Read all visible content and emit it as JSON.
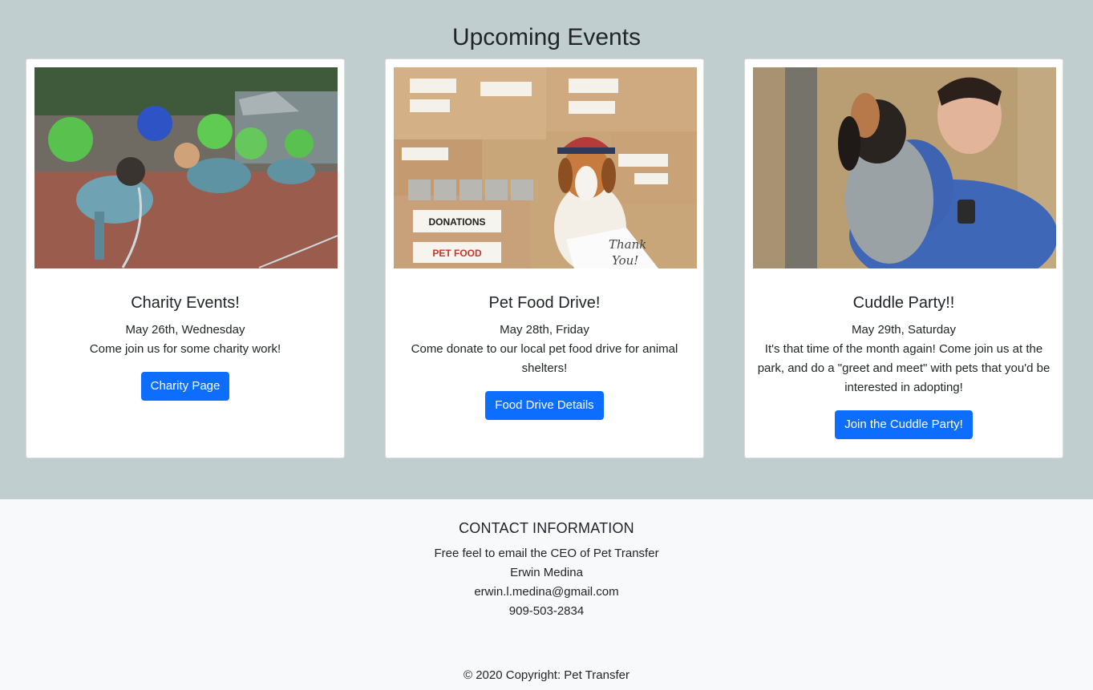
{
  "page_title": "Upcoming Events",
  "events": [
    {
      "title": "Charity Events!",
      "date": "May 26th, Wednesday",
      "description": "Come join us for some charity work!",
      "button": "Charity Page"
    },
    {
      "title": "Pet Food Drive!",
      "date": "May 28th, Friday",
      "description": "Come donate to our local pet food drive for animal shelters!",
      "button": "Food Drive Details",
      "image_text": {
        "box_label_1": "DONATIONS",
        "box_label_2": "PET FOOD",
        "card_line_1": "Thank",
        "card_line_2": "You!"
      }
    },
    {
      "title": "Cuddle Party!!",
      "date": "May 29th, Saturday",
      "description": "It's that time of the month again! Come join us at the park, and do a \"greet and meet\" with pets that you'd be interested in adopting!",
      "button": "Join the Cuddle Party!"
    }
  ],
  "contact": {
    "heading": "CONTACT INFORMATION",
    "intro": "Free feel to email the CEO of Pet Transfer",
    "name": "Erwin Medina",
    "email": "erwin.l.medina@gmail.com",
    "phone": "909-503-2834"
  },
  "copyright": "© 2020 Copyright: Pet Transfer",
  "colors": {
    "events_bg": "#c1ced0",
    "footer_bg": "#f8f9fa",
    "button": "#0d6efd"
  }
}
